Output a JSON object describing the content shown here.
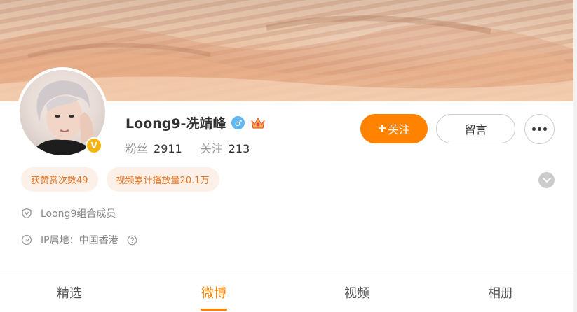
{
  "profile": {
    "name": "Loong9-冼靖峰",
    "verified_badge": "V",
    "gender_icon": "male-icon",
    "gender_symbol": "♂",
    "followers_label": "粉丝",
    "followers_value": "2911",
    "following_label": "关注",
    "following_value": "213"
  },
  "actions": {
    "follow_plus": "+",
    "follow_label": "关注",
    "message_label": "留言",
    "more_icon": "more-dots-icon"
  },
  "tags": [
    {
      "label": "获赞赏次数49"
    },
    {
      "label": "视频累计播放量20.1万"
    }
  ],
  "info": {
    "group_member": "Loong9组合成员",
    "ip_location": "IP属地：中国香港"
  },
  "tabs": [
    {
      "label": "精选"
    },
    {
      "label": "微博"
    },
    {
      "label": "视频"
    },
    {
      "label": "相册"
    }
  ],
  "active_tab": "微博",
  "colors": {
    "accent": "#ff8200",
    "tag_bg": "#fdf0e8",
    "tag_text": "#e8741e",
    "verified": "#f6b40e",
    "gender": "#5fb8f3"
  }
}
